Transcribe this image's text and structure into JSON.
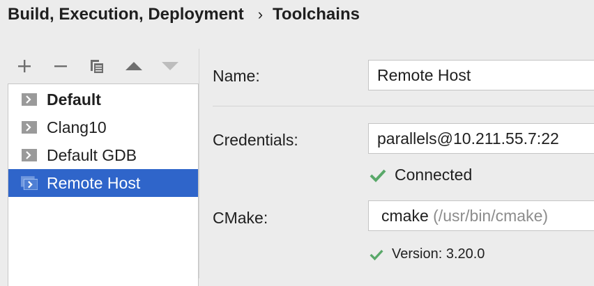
{
  "breadcrumb": {
    "parent": "Build, Execution, Deployment",
    "separator": "›",
    "current": "Toolchains"
  },
  "toolbar": {
    "buttons": [
      {
        "name": "add",
        "icon": "plus-icon"
      },
      {
        "name": "remove",
        "icon": "minus-icon"
      },
      {
        "name": "copy",
        "icon": "copy-icon"
      },
      {
        "name": "move-up",
        "icon": "arrow-up-icon"
      },
      {
        "name": "move-down",
        "icon": "arrow-down-icon",
        "disabled": true
      }
    ]
  },
  "toolchains": [
    {
      "label": "Default",
      "bold": true,
      "selected": false
    },
    {
      "label": "Clang10",
      "bold": false,
      "selected": false
    },
    {
      "label": "Default GDB",
      "bold": false,
      "selected": false
    },
    {
      "label": "Remote Host",
      "bold": false,
      "selected": true
    }
  ],
  "form": {
    "name_label": "Name:",
    "name_value": "Remote Host",
    "credentials_label": "Credentials:",
    "credentials_value": "parallels@10.211.55.7:22",
    "connection_status": "Connected",
    "cmake_label": "CMake:",
    "cmake_value": "cmake",
    "cmake_path": "(/usr/bin/cmake)",
    "cmake_version": "Version: 3.20.0"
  },
  "colors": {
    "selection": "#2f65ca",
    "success": "#59a869",
    "background": "#ececec"
  }
}
